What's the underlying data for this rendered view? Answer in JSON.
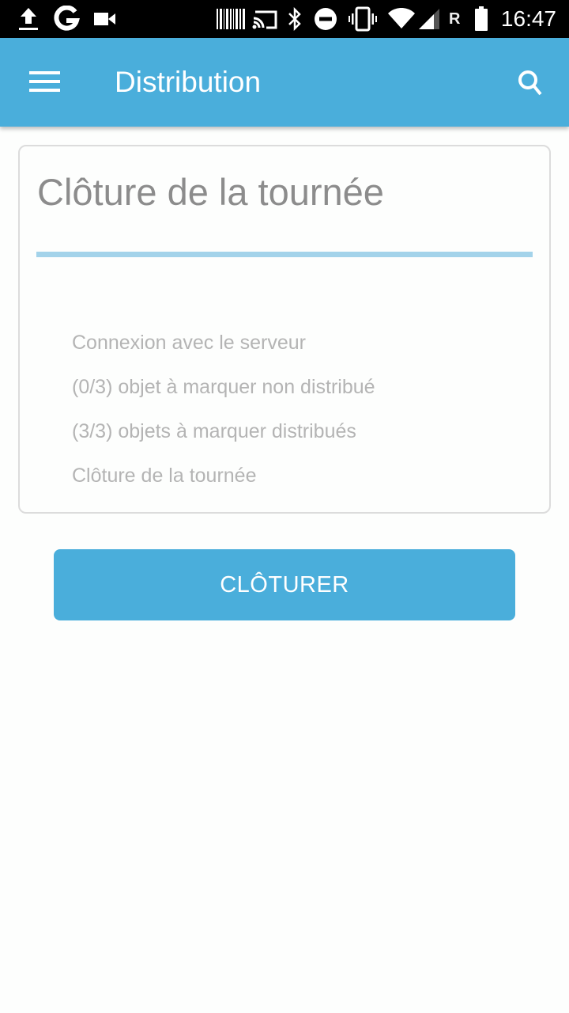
{
  "status_bar": {
    "left_icons": [
      "upload-icon",
      "google-icon",
      "video-camera-icon"
    ],
    "right_icons": [
      "barcode-icon",
      "cast-icon",
      "bluetooth-icon",
      "do-not-disturb-icon",
      "vibrate-icon",
      "wifi-icon",
      "signal-icon",
      "roaming-indicator",
      "battery-icon"
    ],
    "roaming_label": "R",
    "time": "16:47"
  },
  "app_bar": {
    "title": "Distribution",
    "menu_icon": "hamburger-menu-icon",
    "search_icon": "search-icon",
    "color": "#4aaedb"
  },
  "card": {
    "title": "Clôture de la tournée",
    "progress_percent": 100,
    "progress_color": "#a3d3ea",
    "steps": [
      "Connexion avec le serveur",
      "(0/3) objet à marquer non distribué",
      "(3/3) objets à marquer distribués",
      "Clôture de la tournée"
    ]
  },
  "actions": {
    "close_label": "CLÔTURER"
  }
}
